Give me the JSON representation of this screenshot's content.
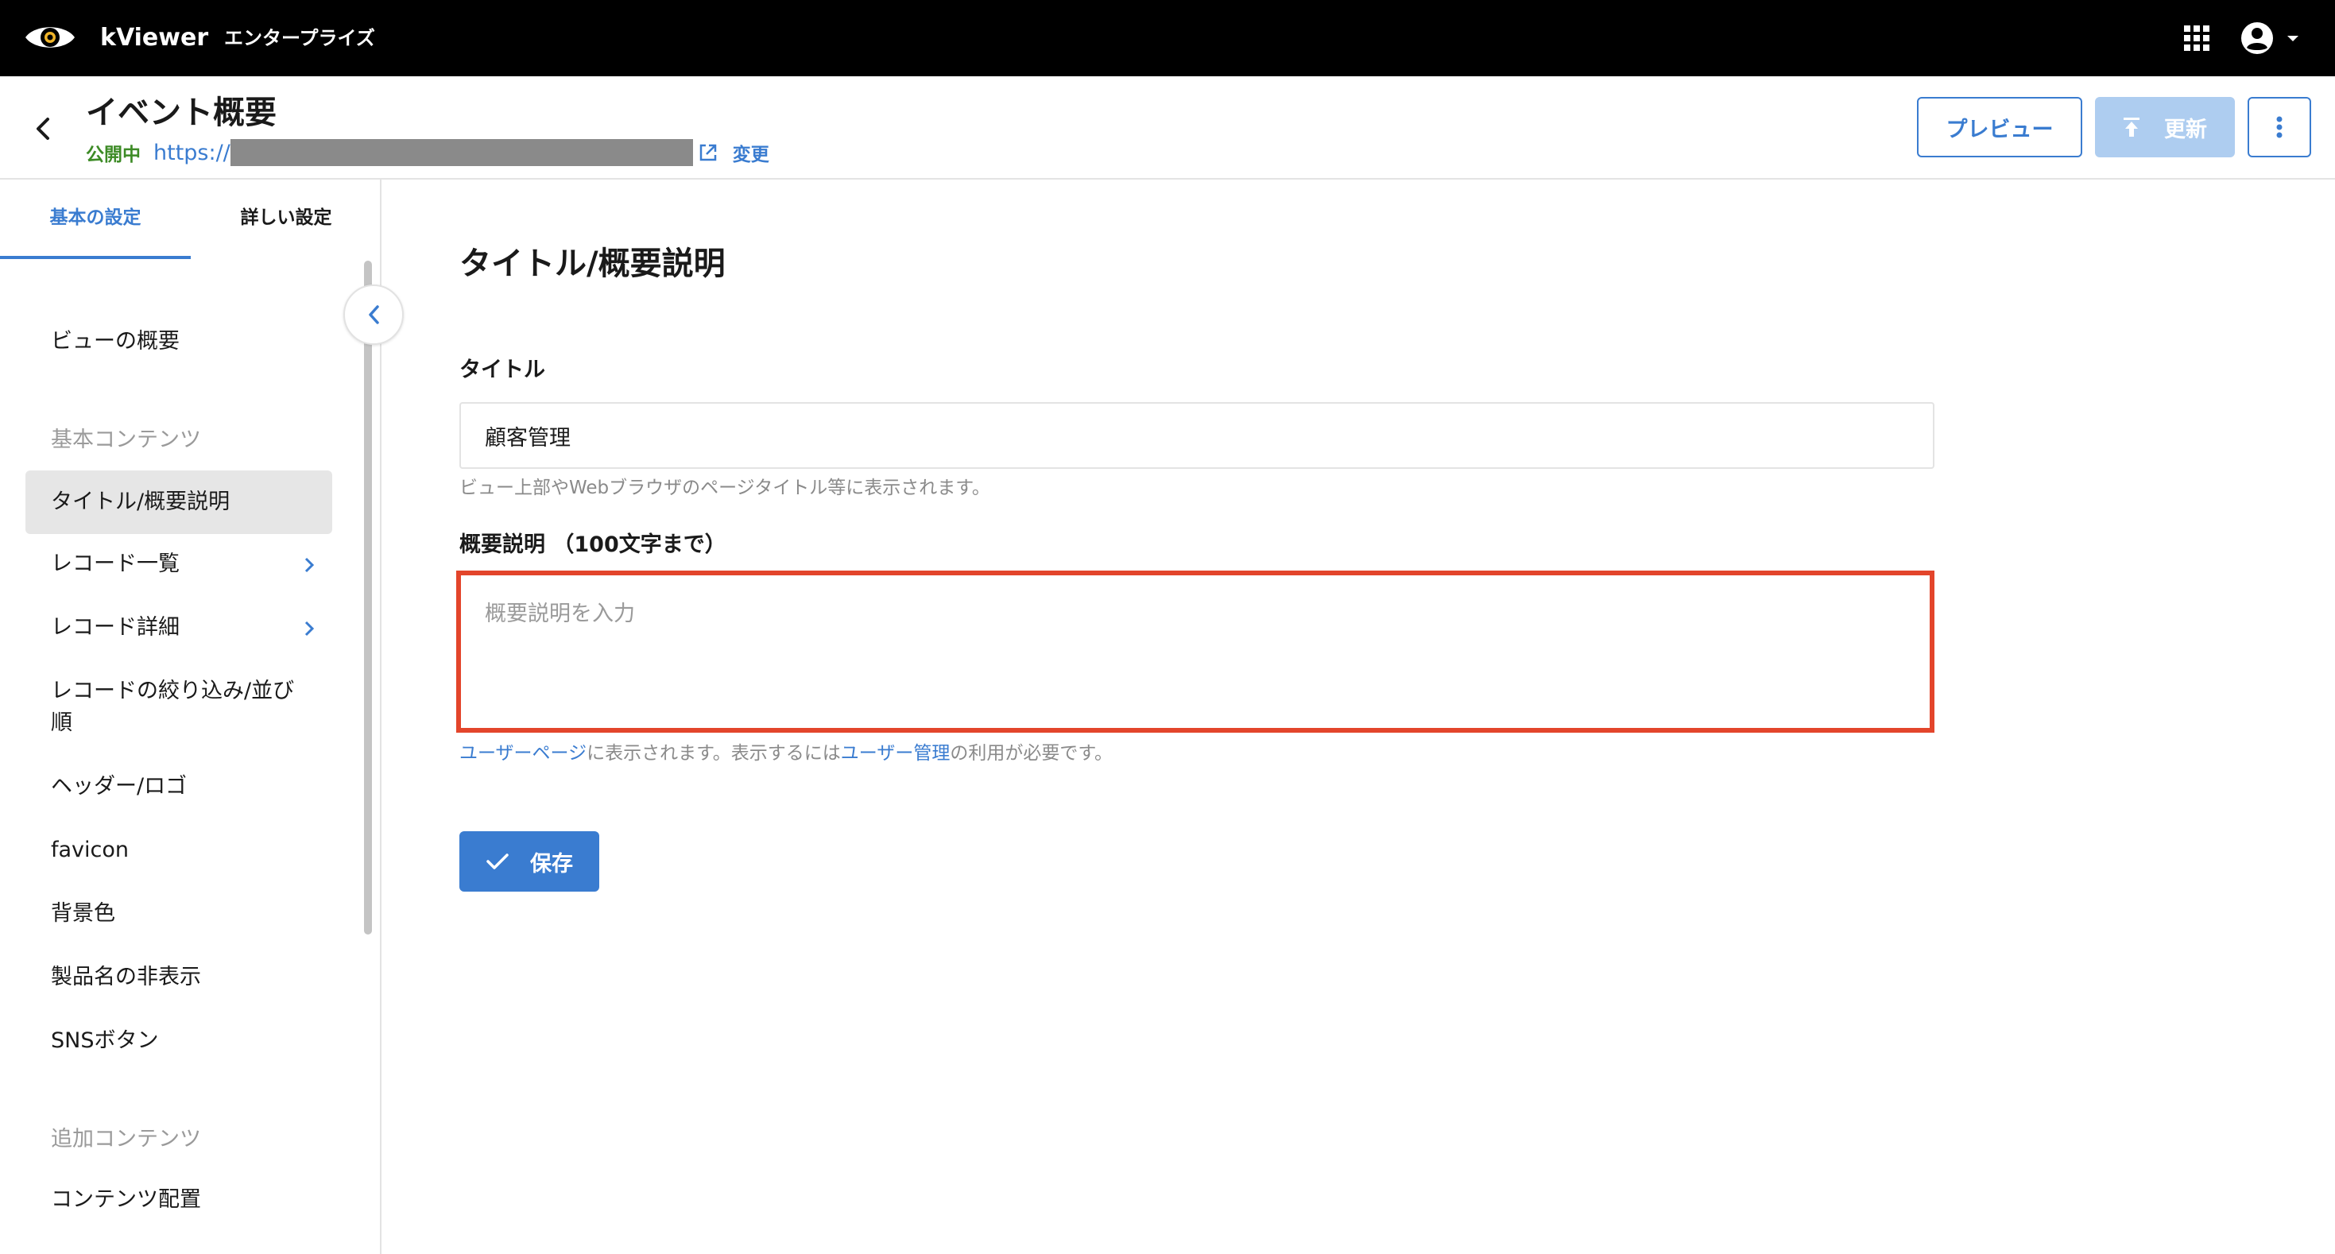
{
  "topbar": {
    "brand": "kViewer",
    "edition": "エンタープライズ",
    "icons": [
      "eye-logo-icon",
      "apps-grid-icon",
      "account-icon",
      "caret-down-icon"
    ]
  },
  "header": {
    "title": "イベント概要",
    "status": "公開中",
    "url_prefix": "https://",
    "change_link": "変更",
    "preview_button": "プレビュー",
    "update_button": "更新"
  },
  "sidebar": {
    "tabs": [
      "基本の設定",
      "詳しい設定"
    ],
    "overview": "ビューの概要",
    "section_basic": "基本コンテンツ",
    "items": [
      "タイトル/概要説明",
      "レコード一覧",
      "レコード詳細",
      "レコードの絞り込み/並び",
      "順",
      "ヘッダー/ロゴ",
      "favicon",
      "背景色",
      "製品名の非表示",
      "SNSボタン"
    ],
    "section_extra": "追加コンテンツ",
    "extra_items": [
      "コンテンツ配置"
    ]
  },
  "main": {
    "section_title": "タイトル/概要説明",
    "title_label": "タイトル",
    "title_value": "顧客管理",
    "title_help": "ビュー上部やWebブラウザのページタイトル等に表示されます。",
    "desc_label": "概要説明 （100文字まで）",
    "desc_placeholder": "概要説明を入力",
    "desc_help_link1": "ユーザーページ",
    "desc_help_mid": "に表示されます。表示するには",
    "desc_help_link2": "ユーザー管理",
    "desc_help_end": "の利用が必要です。",
    "save_button": "保存"
  },
  "colors": {
    "accent": "#3a7cd0",
    "status_green": "#3d8b26",
    "highlight_red": "#e3452b",
    "update_disabled": "#aecdf0"
  }
}
